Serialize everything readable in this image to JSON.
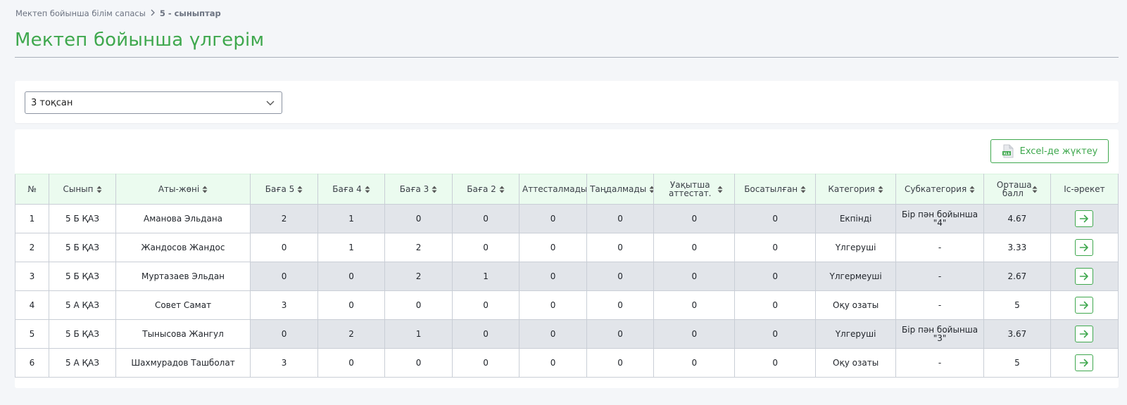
{
  "breadcrumb": {
    "parent": "Мектеп бойынша білім сапасы",
    "separator": ">",
    "current": "5 - сыныптар"
  },
  "page_title": "Мектеп бойынша үлгерім",
  "filter": {
    "selected": "3 тоқсан"
  },
  "export_button": {
    "label": "Excel-де жүктеу",
    "icon": "xls-file-icon"
  },
  "table": {
    "columns": [
      {
        "label": "№",
        "sortable": false
      },
      {
        "label": "Сынып",
        "sortable": true
      },
      {
        "label": "Аты-жөні",
        "sortable": true
      },
      {
        "label": "Баға 5",
        "sortable": true
      },
      {
        "label": "Баға 4",
        "sortable": true
      },
      {
        "label": "Баға 3",
        "sortable": true
      },
      {
        "label": "Баға 2",
        "sortable": true
      },
      {
        "label": "Аттесталмады",
        "sortable": false
      },
      {
        "label": "Таңдалмады",
        "sortable": true
      },
      {
        "label": "Уақытша аттестат.",
        "sortable": true
      },
      {
        "label": "Босатылған",
        "sortable": true
      },
      {
        "label": "Категория",
        "sortable": true
      },
      {
        "label": "Субкатегория",
        "sortable": true
      },
      {
        "label": "Орташа балл",
        "sortable": true
      },
      {
        "label": "Іс-әрекет",
        "sortable": false
      }
    ],
    "rows": [
      {
        "no": "1",
        "class": "5 Б ҚАЗ",
        "name": "Аманова Эльдана",
        "g5": "2",
        "g4": "1",
        "g3": "0",
        "g2": "0",
        "not_att": "0",
        "not_sel": "0",
        "temp": "0",
        "exempt": "0",
        "category": "Екпінді",
        "subcategory": "Бір пән бойынша \"4\"",
        "avg": "4.67"
      },
      {
        "no": "2",
        "class": "5 Б ҚАЗ",
        "name": "Жандосов Жандос",
        "g5": "0",
        "g4": "1",
        "g3": "2",
        "g2": "0",
        "not_att": "0",
        "not_sel": "0",
        "temp": "0",
        "exempt": "0",
        "category": "Үлгеруші",
        "subcategory": "-",
        "avg": "3.33"
      },
      {
        "no": "3",
        "class": "5 Б ҚАЗ",
        "name": "Муртазаев Эльдан",
        "g5": "0",
        "g4": "0",
        "g3": "2",
        "g2": "1",
        "not_att": "0",
        "not_sel": "0",
        "temp": "0",
        "exempt": "0",
        "category": "Үлгермеуші",
        "subcategory": "-",
        "avg": "2.67"
      },
      {
        "no": "4",
        "class": "5 А ҚАЗ",
        "name": "Совет Самат",
        "g5": "3",
        "g4": "0",
        "g3": "0",
        "g2": "0",
        "not_att": "0",
        "not_sel": "0",
        "temp": "0",
        "exempt": "0",
        "category": "Оқу озаты",
        "subcategory": "-",
        "avg": "5"
      },
      {
        "no": "5",
        "class": "5 Б ҚАЗ",
        "name": "Тынысова Жангул",
        "g5": "0",
        "g4": "2",
        "g3": "1",
        "g2": "0",
        "not_att": "0",
        "not_sel": "0",
        "temp": "0",
        "exempt": "0",
        "category": "Үлгеруші",
        "subcategory": "Бір пән бойынша \"3\"",
        "avg": "3.67"
      },
      {
        "no": "6",
        "class": "5 А ҚАЗ",
        "name": "Шахмурадов Ташболат",
        "g5": "3",
        "g4": "0",
        "g3": "0",
        "g2": "0",
        "not_att": "0",
        "not_sel": "0",
        "temp": "0",
        "exempt": "0",
        "category": "Оқу озаты",
        "subcategory": "-",
        "avg": "5"
      }
    ]
  },
  "colors": {
    "accent": "#3fa84e",
    "header_bg": "#ebfbef",
    "shaded_cell": "#e2e5ea"
  }
}
